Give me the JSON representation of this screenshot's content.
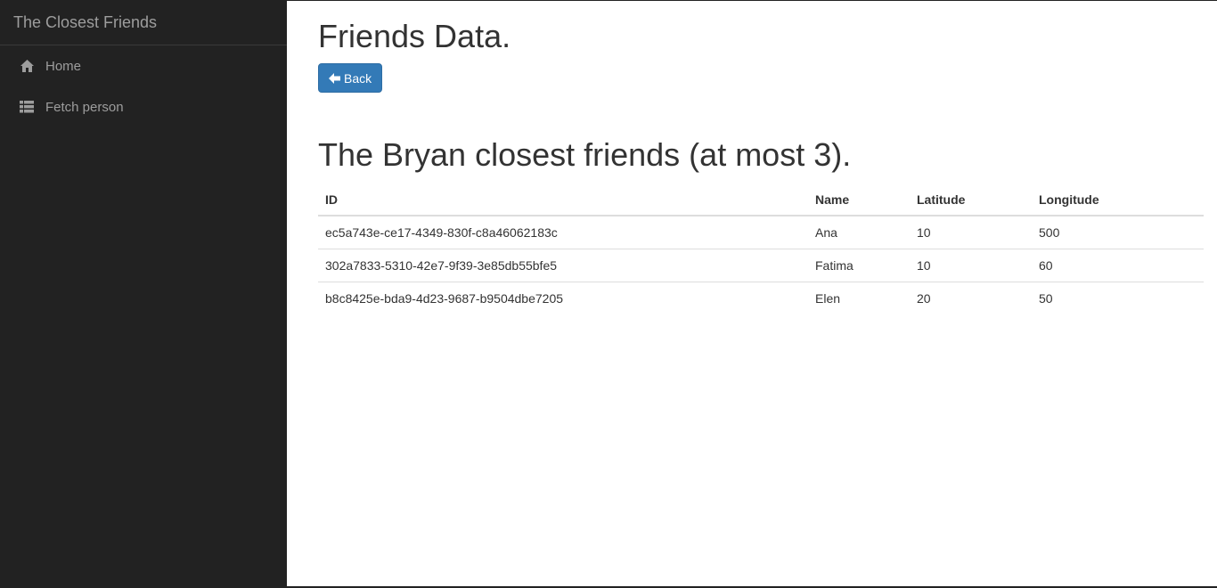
{
  "app": {
    "brand": "The Closest Friends"
  },
  "sidebar": {
    "items": [
      {
        "label": "Home",
        "icon": "home-icon"
      },
      {
        "label": "Fetch person",
        "icon": "list-icon"
      }
    ]
  },
  "main": {
    "title": "Friends Data.",
    "back_label": "Back",
    "section_title": "The Bryan closest friends (at most 3).",
    "table": {
      "headers": [
        "ID",
        "Name",
        "Latitude",
        "Longitude"
      ],
      "rows": [
        [
          "ec5a743e-ce17-4349-830f-c8a46062183c",
          "Ana",
          "10",
          "500"
        ],
        [
          "302a7833-5310-42e7-9f39-3e85db55bfe5",
          "Fatima",
          "10",
          "60"
        ],
        [
          "b8c8425e-bda9-4d23-9687-b9504dbe7205",
          "Elen",
          "20",
          "50"
        ]
      ]
    }
  },
  "colors": {
    "sidebar_bg": "#222222",
    "sidebar_text": "#9d9d9d",
    "primary": "#337ab7"
  }
}
